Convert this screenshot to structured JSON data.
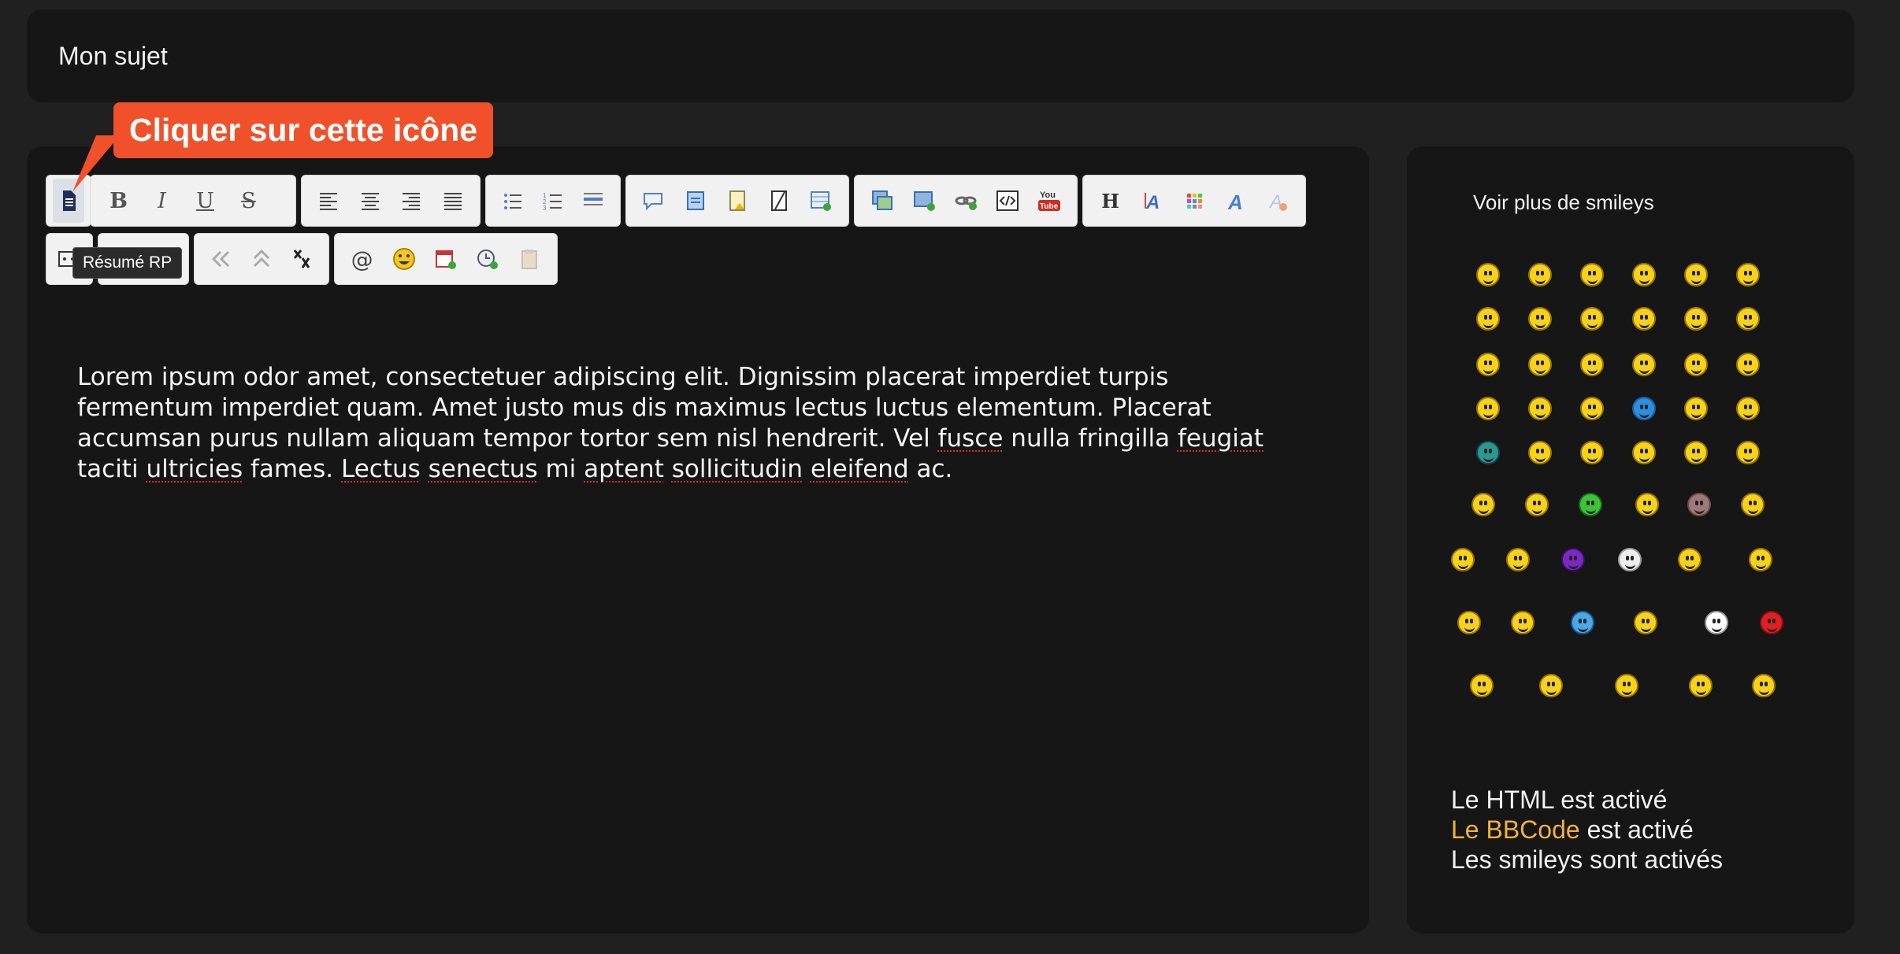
{
  "subject": {
    "value": "Mon sujet"
  },
  "callout": {
    "text": "Cliquer sur cette icône",
    "color": "#f0502a"
  },
  "tooltip": {
    "text": "Résumé RP"
  },
  "toolbar": {
    "row1": [
      [
        "resume-rp-icon"
      ],
      [
        "bold-icon",
        "italic-icon",
        "underline-icon",
        "strikethrough-icon"
      ],
      [
        "align-left-icon",
        "align-center-icon",
        "align-right-icon",
        "justify-icon"
      ],
      [
        "bulleted-list-icon",
        "numbered-list-icon",
        "horizontal-rule-icon"
      ],
      [
        "quote-icon",
        "script-icon",
        "spoiler-icon",
        "hide-icon",
        "table-icon"
      ],
      [
        "image-icon",
        "upload-image-icon",
        "link-icon",
        "code-icon",
        "youtube-icon"
      ],
      [
        "heading-icon",
        "font-size-icon",
        "color-icon",
        "font-icon",
        "clear-format-icon"
      ]
    ],
    "row2": [
      [
        "source-icon"
      ],
      [
        "blank-icon"
      ],
      [
        "undo-icon",
        "redo-icon",
        "cut-icon"
      ],
      [
        "mention-icon",
        "smiley-icon",
        "date-icon",
        "time-icon",
        "paste-icon"
      ]
    ],
    "labels": {
      "bold": "B",
      "italic": "I",
      "underline": "U",
      "strike": "S",
      "heading": "H",
      "mention": "@",
      "youtube": "You\nTube"
    }
  },
  "content": {
    "paragraph": [
      "Lorem ipsum odor amet, consectetuer adipiscing elit. Dignissim placerat imperdiet turpis",
      "fermentum imperdiet quam. Amet justo mus dis maximus lectus luctus elementum. Placerat",
      "accumsan purus nullam aliquam tempor tortor sem nisl hendrerit. Vel fusce nulla fringilla feugiat",
      "taciti ultricies fames. Lectus senectus mi aptent sollicitudin eleifend ac."
    ]
  },
  "sidebar": {
    "more_smileys": "Voir plus de smileys",
    "status": {
      "html": "Le HTML est activé",
      "bbcode_link": "Le BBCode",
      "bbcode_rest": " est activé",
      "smileys": "Les smileys sont activés"
    }
  },
  "colors": {
    "page_bg": "#202020",
    "panel_bg": "#161616",
    "accent": "#f1b23a"
  }
}
